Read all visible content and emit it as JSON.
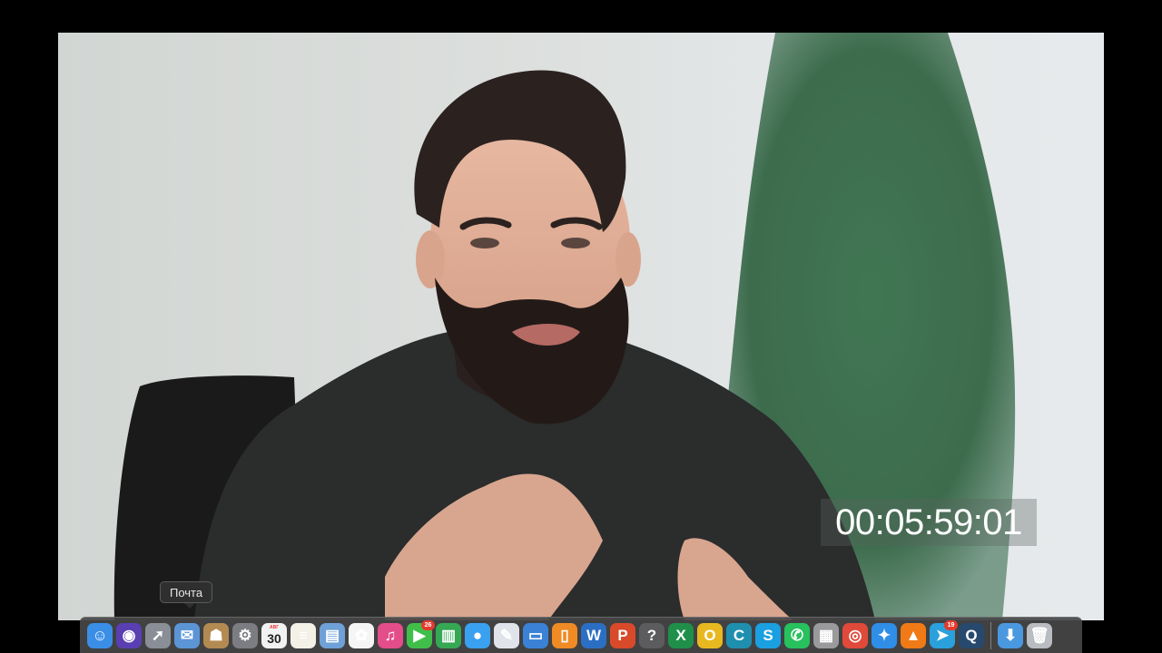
{
  "video": {
    "timecode": "00:05:59:01"
  },
  "tooltip": {
    "label": "Почта"
  },
  "dock": {
    "items": [
      {
        "name": "finder-icon",
        "glyph": "☺",
        "color": "#3a8ee6"
      },
      {
        "name": "siri-icon",
        "glyph": "◉",
        "color": "#5a3fb3"
      },
      {
        "name": "launchpad-icon",
        "glyph": "➚",
        "color": "#8a8e96"
      },
      {
        "name": "mail-icon",
        "glyph": "✉",
        "color": "#5c95d6"
      },
      {
        "name": "contacts-icon",
        "glyph": "☗",
        "color": "#b38a52"
      },
      {
        "name": "system-preferences-icon",
        "glyph": "⚙",
        "color": "#7b7d82"
      },
      {
        "name": "calendar-icon",
        "glyph": "",
        "color": "#f2f2f2",
        "date_header": "АВГ",
        "date": "30"
      },
      {
        "name": "notes-icon",
        "glyph": "≡",
        "color": "#f3f0e6"
      },
      {
        "name": "preview-icon",
        "glyph": "▤",
        "color": "#6fa0d8"
      },
      {
        "name": "photos-icon",
        "glyph": "✿",
        "color": "#f5f5f5"
      },
      {
        "name": "itunes-icon",
        "glyph": "♫",
        "color": "#e34d8a"
      },
      {
        "name": "facetime-icon",
        "glyph": "▶",
        "color": "#3fbf4a",
        "badge": "26"
      },
      {
        "name": "numbers-icon",
        "glyph": "▥",
        "color": "#35a853"
      },
      {
        "name": "messages-icon",
        "glyph": "●",
        "color": "#3aa0f0"
      },
      {
        "name": "textedit-icon",
        "glyph": "✎",
        "color": "#e0e4ea"
      },
      {
        "name": "keynote-icon",
        "glyph": "▭",
        "color": "#3b82d6"
      },
      {
        "name": "ibooks-icon",
        "glyph": "▯",
        "color": "#f08a24"
      },
      {
        "name": "word-icon",
        "glyph": "W",
        "color": "#2b6fc4"
      },
      {
        "name": "powerpoint-icon",
        "glyph": "P",
        "color": "#d94a2a"
      },
      {
        "name": "help-icon",
        "glyph": "?",
        "color": "#5c5c5e"
      },
      {
        "name": "excel-icon",
        "glyph": "X",
        "color": "#1f8f4a"
      },
      {
        "name": "outlook-icon",
        "glyph": "O",
        "color": "#e8b820"
      },
      {
        "name": "c-app-icon",
        "glyph": "C",
        "color": "#1f8fb0"
      },
      {
        "name": "skype-icon",
        "glyph": "S",
        "color": "#1aa0e0"
      },
      {
        "name": "whatsapp-icon",
        "glyph": "✆",
        "color": "#27c15e"
      },
      {
        "name": "archive-icon",
        "glyph": "▦",
        "color": "#9a9a9c"
      },
      {
        "name": "chrome-icon",
        "glyph": "◎",
        "color": "#e04a3a"
      },
      {
        "name": "safari-icon",
        "glyph": "✦",
        "color": "#2f8ee6"
      },
      {
        "name": "vlc-icon",
        "glyph": "▲",
        "color": "#f07a16"
      },
      {
        "name": "telegram-icon",
        "glyph": "➤",
        "color": "#2aa0dc",
        "badge": "19"
      },
      {
        "name": "quicktime-icon",
        "glyph": "Q",
        "color": "#27496e"
      },
      {
        "name": "separator"
      },
      {
        "name": "downloads-icon",
        "glyph": "⬇",
        "color": "#4a98e0"
      },
      {
        "name": "trash-icon",
        "glyph": "🗑",
        "color": "#b9bcc0"
      }
    ]
  }
}
